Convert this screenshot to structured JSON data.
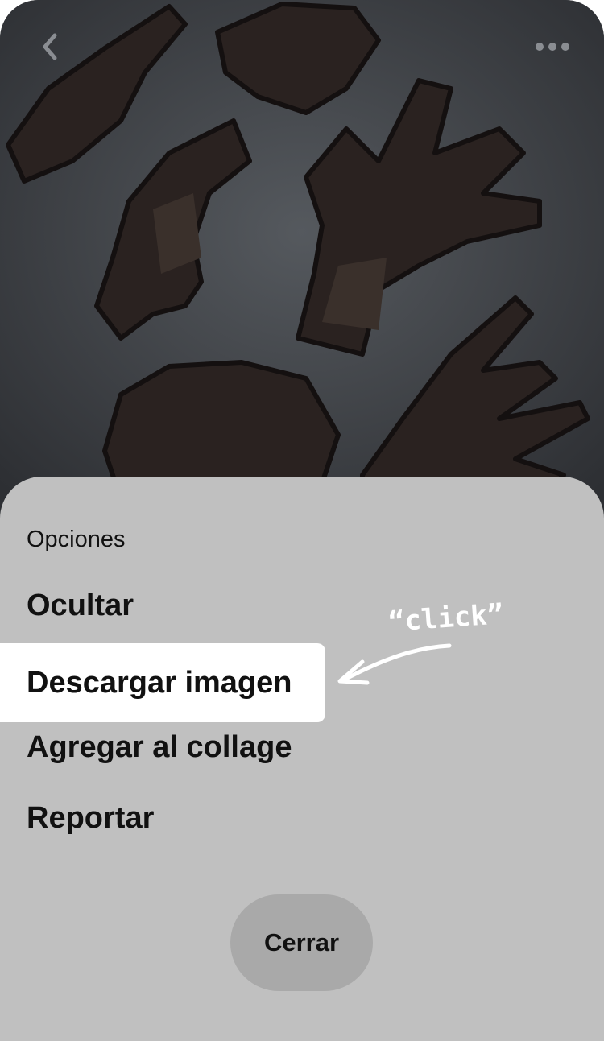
{
  "icons": {
    "back": "chevron-left-icon",
    "more": "more-horizontal-icon",
    "arrow": "hand-drawn-arrow-icon"
  },
  "colors": {
    "sheet_background": "#c0c0c0",
    "highlight": "#ffffff",
    "close_button": "#a9a9a9",
    "image_background": "#3a3d41"
  },
  "sheet": {
    "title": "Opciones",
    "options": [
      {
        "label": "Ocultar",
        "highlighted": false
      },
      {
        "label": "Descargar imagen",
        "highlighted": true
      },
      {
        "label": "Agregar al collage",
        "highlighted": false
      },
      {
        "label": "Reportar",
        "highlighted": false
      }
    ],
    "close_label": "Cerrar"
  },
  "annotation": {
    "text": "“click”"
  }
}
